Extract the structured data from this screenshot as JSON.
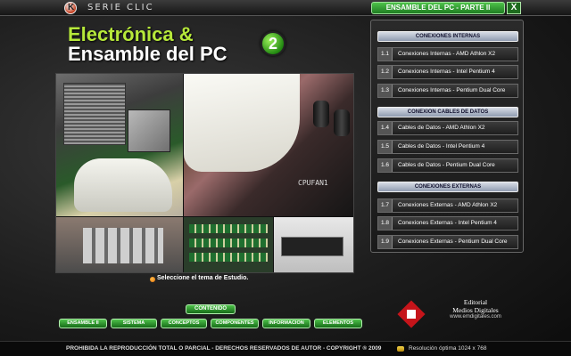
{
  "app": {
    "series": "SERIE CLIC",
    "window_title": "ENSAMBLE DEL PC - PARTE II",
    "close_label": "X",
    "title_line1": "Electrónica &",
    "title_line2": "Ensamble del PC",
    "part_number": "2",
    "hint": "Seleccione el tema de Estudio.",
    "photo_silk": "CPUFAN1"
  },
  "panel": {
    "sections": [
      {
        "header": "CONEXIONES INTERNAS",
        "topics": [
          {
            "num": "1.1",
            "label": "Conexiones Internas - AMD Athlon X2"
          },
          {
            "num": "1.2",
            "label": "Conexiones Internas - Intel Pentium 4"
          },
          {
            "num": "1.3",
            "label": "Conexiones Internas - Pentium Dual Core"
          }
        ]
      },
      {
        "header": "CONEXION CABLES DE DATOS",
        "topics": [
          {
            "num": "1.4",
            "label": "Cables de Datos - AMD Athlon X2"
          },
          {
            "num": "1.5",
            "label": "Cables de Datos - Intel Pentium 4"
          },
          {
            "num": "1.6",
            "label": "Cables de Datos - Pentium Dual Core"
          }
        ]
      },
      {
        "header": "CONEXIONES EXTERNAS",
        "topics": [
          {
            "num": "1.7",
            "label": "Conexiones Externas - AMD Athlon X2"
          },
          {
            "num": "1.8",
            "label": "Conexiones Externas - Intel Pentium 4"
          },
          {
            "num": "1.9",
            "label": "Conexiones Externas - Pentium Dual Core"
          }
        ]
      }
    ]
  },
  "nav": {
    "content_label": "CONTENIDO",
    "items": [
      "ENSAMBLE II",
      "SISTEMA",
      "CONCEPTOS",
      "COMPONENTES",
      "INFORMACION",
      "ELEMENTOS"
    ]
  },
  "publisher": {
    "line1": "Editorial",
    "line2": "Medios Digitales",
    "line3": "www.emdigitales.com"
  },
  "footer": {
    "copyright": "PROHIBIDA LA REPRODUCCIÓN TOTAL O PARCIAL - DERECHOS RESERVADOS DE AUTOR - COPYRIGHT ® 2009",
    "resolution": "Resolución óptima 1024 x 768"
  },
  "colors": {
    "accent_green": "#4ec24a",
    "title_green": "#b6e83a",
    "publisher_red": "#c5141a"
  }
}
